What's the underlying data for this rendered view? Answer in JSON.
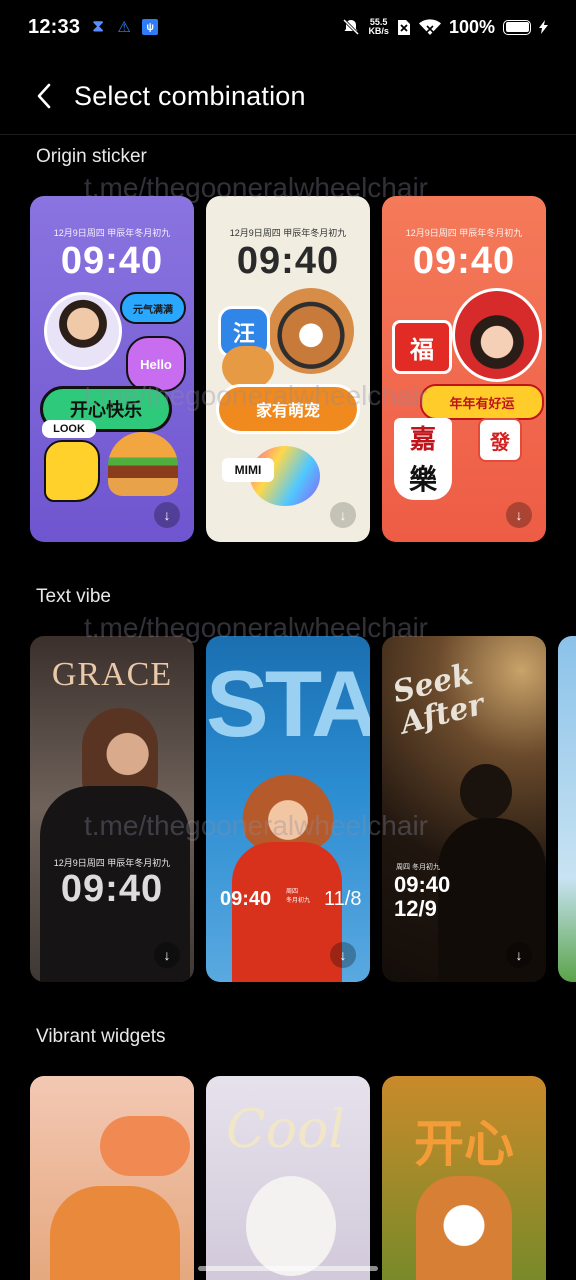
{
  "status_bar": {
    "time": "12:33",
    "net_speed_value": "55.5",
    "net_speed_unit": "KB/s",
    "battery": "100%"
  },
  "header": {
    "title": "Select combination"
  },
  "sections": [
    {
      "title": "Origin sticker",
      "cards": [
        {
          "date": "12月9日周四 甲辰年冬月初九",
          "time": "09:40",
          "stickers": [
            "元气满满",
            "Hello",
            "开心快乐",
            "LOOK"
          ]
        },
        {
          "date": "12月9日周四 甲辰年冬月初九",
          "time": "09:40",
          "stickers": [
            "汪",
            "家有萌宠",
            "MIMI"
          ]
        },
        {
          "date": "12月9日周四 甲辰年冬月初九",
          "time": "09:40",
          "stickers": [
            "福",
            "年年有好运",
            "嘉",
            "樂",
            "發"
          ]
        }
      ]
    },
    {
      "title": "Text vibe",
      "cards": [
        {
          "headline": "GRACE",
          "date": "12月9日周四 甲辰年冬月初九",
          "time": "09:40"
        },
        {
          "headline": "STAR",
          "time": "09:40",
          "date_small": "周四",
          "date_small2": "冬月初九",
          "date": "11/8"
        },
        {
          "headline": "Seek After",
          "date_small": "周四 冬月初九",
          "time": "09:40",
          "date": "12/9"
        }
      ]
    },
    {
      "title": "Vibrant widgets",
      "cards": [
        {
          "art_text": ""
        },
        {
          "art_text": "Cool"
        },
        {
          "art_text": "开心"
        }
      ]
    }
  ],
  "watermark": "t.me/thegooneralwheelchair",
  "colors": {
    "background": "#000000",
    "card1_bg": "#7d63d6",
    "card2_bg": "#f1ede1",
    "card3_bg": "#f26b4f"
  }
}
